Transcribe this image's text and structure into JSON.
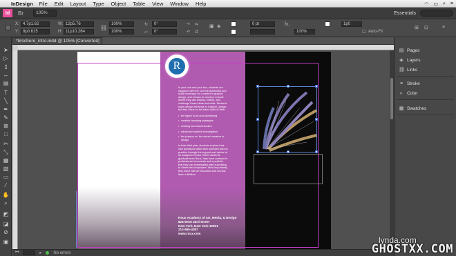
{
  "menubar": {
    "app_name": "InDesign",
    "items": [
      "File",
      "Edit",
      "Layout",
      "Type",
      "Object",
      "Table",
      "View",
      "Window",
      "Help"
    ]
  },
  "appbar": {
    "logo": "Id",
    "bridge": "Br",
    "zoom": "105%",
    "workspace": "Essentials"
  },
  "control": {
    "x_label": "X:",
    "x_value": "4.7p1.62",
    "y_label": "Y:",
    "y_value": "8p0.615",
    "w_label": "W:",
    "w_value": "12p5.76",
    "h_label": "H:",
    "h_value": "11p10.264",
    "scale_x": "100%",
    "scale_y": "100%",
    "rotate": "0°",
    "shear": "0°",
    "stroke_weight": "0 pt",
    "fx_label": "fx.",
    "frame_size": "1p0",
    "opacity": "100%",
    "auto_fit": "Auto-Fit"
  },
  "document": {
    "tab_title": "*brochure_intro.indd @ 105% [Converted]"
  },
  "page": {
    "badge_letter": "R",
    "intro": "In your one and your two, students are equipped with the core fundamentals and skills necessary for a career in graphic design, and choose an elective module where they can employ, extend, and challenge these ideas and skills. Students study design elements in Graphic Design, but also focus on the basic skills of Web.",
    "bullets": [
      "the figure in art and advertising",
      "creative branding strategies",
      "drawing and visual studies",
      "advanced material investigation",
      "the physics vs. the virtual narrative in design"
    ],
    "second_para": "In their third year, students explore their own questions within their selected area of practice through the support and advice of an assigned mentor. When students graduate from Roux, they have contacts in professional community and a portfolio that they can immediately start submitting to clients and employers. Most importantly, they leave with an education that will last them a lifetime.",
    "address_lines": [
      "Roux Academy of Art, Media, & Design",
      "824 West 33rd Street",
      "New York, New York 10001",
      "212-555-4357",
      "www.roux.com"
    ]
  },
  "status": {
    "errors": "No errors"
  },
  "panels": {
    "group1": [
      {
        "icon": "pages-icon",
        "label": "Pages"
      },
      {
        "icon": "layers-icon",
        "label": "Layers"
      },
      {
        "icon": "links-icon",
        "label": "Links"
      }
    ],
    "group2": [
      {
        "icon": "stroke-icon",
        "label": "Stroke"
      },
      {
        "icon": "color-icon",
        "label": "Color"
      }
    ],
    "group3": [
      {
        "icon": "swatches-icon",
        "label": "Swatches"
      }
    ]
  },
  "watermark": {
    "top": "lynda.com",
    "main": "GHOSTXX.COM"
  },
  "colors": {
    "page_purple": "#b15bb0",
    "page_black": "#0b0b0b",
    "guide_magenta": "#c43fc4",
    "selection_blue": "#5a86d6"
  }
}
